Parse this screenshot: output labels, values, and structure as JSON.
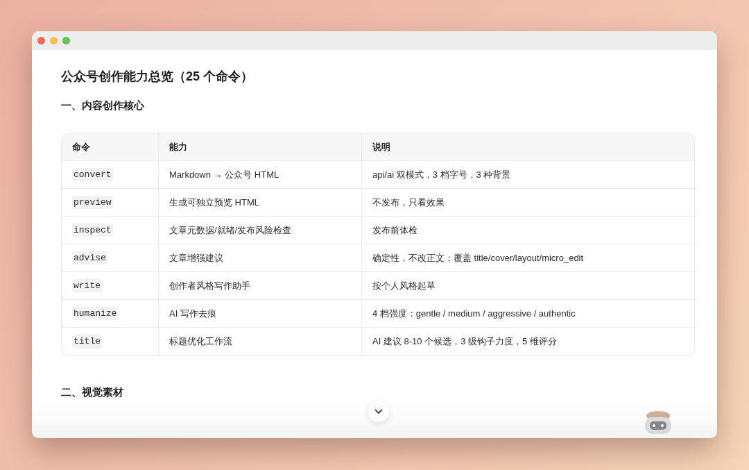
{
  "title": "公众号创作能力总览（25 个命令）",
  "section_1": {
    "heading": "一、内容创作核心",
    "table": {
      "columns": [
        "命令",
        "能力",
        "说明"
      ],
      "rows": [
        {
          "command": "convert",
          "ability": "Markdown → 公众号 HTML",
          "note": "api/ai 双模式，3 档字号，3 种背景"
        },
        {
          "command": "preview",
          "ability": "生成可独立预览 HTML",
          "note": "不发布，只看效果"
        },
        {
          "command": "inspect",
          "ability": "文章元数据/就绪/发布风险检查",
          "note": "发布前体检"
        },
        {
          "command": "advise",
          "ability": "文章增强建议",
          "note": "确定性，不改正文；覆盖 title/cover/layout/micro_edit"
        },
        {
          "command": "write",
          "ability": "创作者风格写作助手",
          "note": "按个人风格起草"
        },
        {
          "command": "humanize",
          "ability": "AI 写作去痕",
          "note": "4 档强度：gentle / medium / aggressive / authentic"
        },
        {
          "command": "title",
          "ability": "标题优化工作流",
          "note": "AI 建议 8-10 个候选，3 级钩子力度，5 维评分"
        }
      ]
    }
  },
  "section_2": {
    "heading": "二、视觉素材"
  }
}
